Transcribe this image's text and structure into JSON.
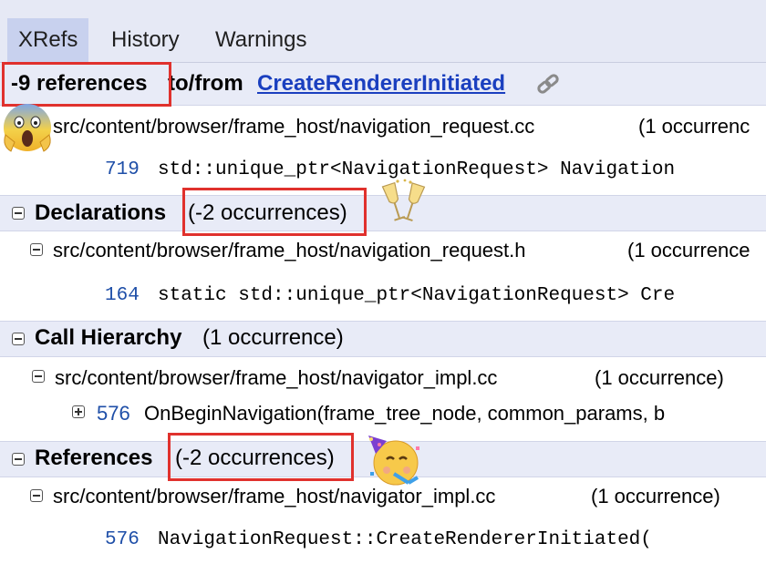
{
  "tabs": [
    {
      "label": "XRefs",
      "active": true
    },
    {
      "label": "History",
      "active": false
    },
    {
      "label": "Warnings",
      "active": false
    }
  ],
  "header": {
    "count_text": "-9 references",
    "to_from": "to/from",
    "symbol_link": "CreateRendererInitiated"
  },
  "top_file": {
    "path": "src/content/browser/frame_host/navigation_request.cc",
    "occ": "(1 occurrenc",
    "line_num": "719",
    "code": "std::unique_ptr<NavigationRequest> Navigation"
  },
  "declarations": {
    "title": "Declarations",
    "count": "(-2 occurrences)",
    "file_path": "src/content/browser/frame_host/navigation_request.h",
    "file_occ": "(1 occurrence",
    "line_num": "164",
    "code": "static std::unique_ptr<NavigationRequest> Cre"
  },
  "call_hierarchy": {
    "title": "Call Hierarchy",
    "count": "(1 occurrence)",
    "file_path": "src/content/browser/frame_host/navigator_impl.cc",
    "file_occ": "(1 occurrence)",
    "line_num": "576",
    "code": "OnBeginNavigation(frame_tree_node, common_params, b"
  },
  "references": {
    "title": "References",
    "count": "(-2 occurrences)",
    "file_path": "src/content/browser/frame_host/navigator_impl.cc",
    "file_occ": "(1 occurrence)",
    "line_num": "576",
    "code": "NavigationRequest::CreateRendererInitiated("
  },
  "colors": {
    "highlight_box": "#e0312d",
    "link": "#1a3fbf",
    "line_number": "#1f4fa8",
    "section_bg": "#e8ebf7"
  },
  "icons": [
    "collapse-icon",
    "expand-icon",
    "screaming-face-emoji",
    "clinking-glasses-emoji",
    "partying-face-emoji",
    "link-chain-icon"
  ]
}
